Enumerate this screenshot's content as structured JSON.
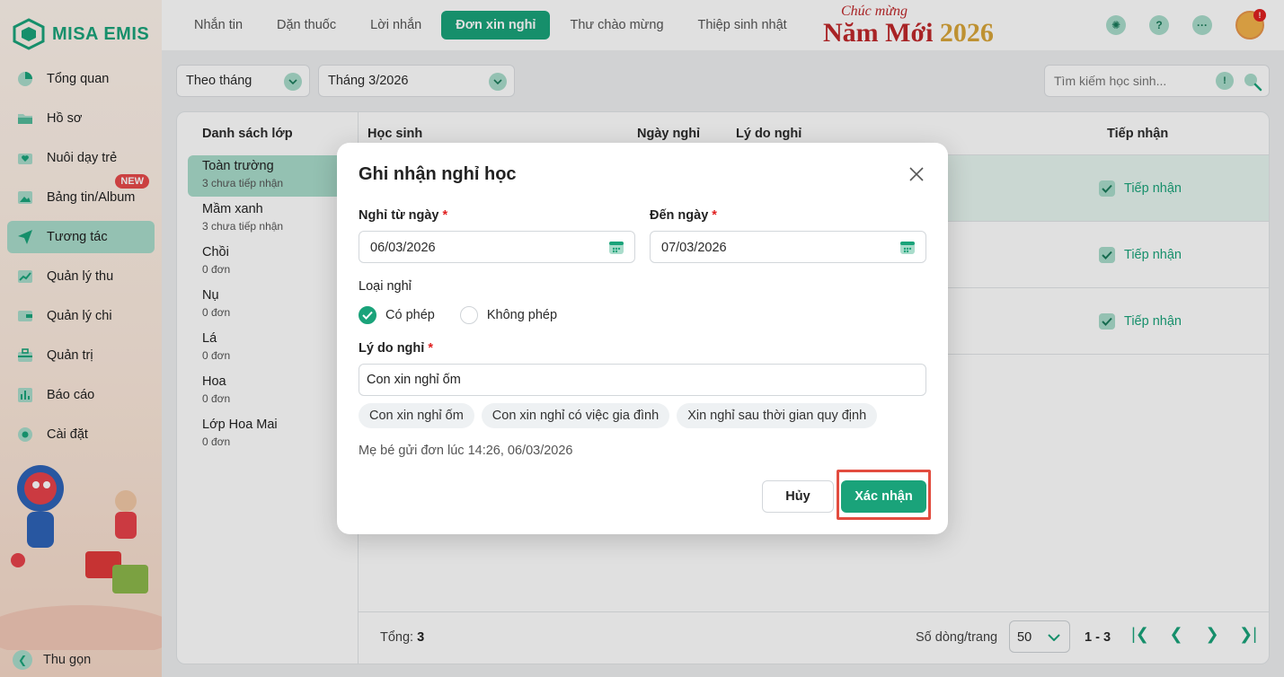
{
  "app": {
    "logo_text": "MISA EMIS"
  },
  "colors": {
    "brand": "#1aa37a",
    "brand_light": "#a9dccb",
    "danger": "#e02020",
    "highlight": "#e24c3f"
  },
  "sidebar": {
    "items": [
      {
        "label": "Tổng quan",
        "icon": "pie-chart-icon"
      },
      {
        "label": "Hồ sơ",
        "icon": "folder-icon"
      },
      {
        "label": "Nuôi dạy trẻ",
        "icon": "heart-box-icon"
      },
      {
        "label": "Bảng tin/Album",
        "icon": "image-icon",
        "badge": "NEW"
      },
      {
        "label": "Tương tác",
        "icon": "send-icon",
        "active": true
      },
      {
        "label": "Quản lý thu",
        "icon": "chart-up-icon"
      },
      {
        "label": "Quản lý chi",
        "icon": "wallet-icon"
      },
      {
        "label": "Quản trị",
        "icon": "briefcase-icon"
      },
      {
        "label": "Báo cáo",
        "icon": "bar-chart-icon"
      },
      {
        "label": "Cài đặt",
        "icon": "gear-icon"
      }
    ],
    "collapse_label": "Thu gọn"
  },
  "topbar": {
    "tabs": [
      {
        "label": "Nhắn tin"
      },
      {
        "label": "Dặn thuốc"
      },
      {
        "label": "Lời nhắn"
      },
      {
        "label": "Đơn xin nghỉ",
        "active": true
      },
      {
        "label": "Thư chào mừng"
      },
      {
        "label": "Thiệp sinh nhật"
      }
    ],
    "banner_line1": "Chúc mừng",
    "banner_line2_a": "Năm Mới ",
    "banner_line2_b": "2026",
    "help_symbol": "?",
    "more_symbol": "···",
    "notif_badge": "!"
  },
  "filters": {
    "period_type": "Theo tháng",
    "month": "Tháng 3/2026",
    "search_placeholder": "Tìm kiếm học sinh...",
    "search_info_symbol": "!"
  },
  "class_list": {
    "header": "Danh sách lớp",
    "items": [
      {
        "name": "Toàn trường",
        "sub": "3 chưa tiếp nhận",
        "count": "3",
        "active": true
      },
      {
        "name": "Mầm xanh",
        "sub": "3 chưa tiếp nhận",
        "count": "3"
      },
      {
        "name": "Chồi",
        "sub": "0 đơn"
      },
      {
        "name": "Nụ",
        "sub": "0 đơn"
      },
      {
        "name": "Lá",
        "sub": "0 đơn"
      },
      {
        "name": "Hoa",
        "sub": "0 đơn"
      },
      {
        "name": "Lớp Hoa Mai",
        "sub": "0 đơn"
      }
    ]
  },
  "table": {
    "columns": [
      "Học sinh",
      "Ngày nghỉ",
      "Lý do nghỉ",
      "Tiếp nhận"
    ],
    "rows": [
      {
        "action": "Tiếp nhận"
      },
      {
        "action": "Tiếp nhận"
      },
      {
        "action": "Tiếp nhận"
      }
    ]
  },
  "footer": {
    "total_label": "Tổng:",
    "total_value": "3",
    "rows_per_page_label": "Số dòng/trang",
    "rows_per_page_value": "50",
    "range": "1 - 3"
  },
  "modal": {
    "title": "Ghi nhận nghỉ học",
    "from_label": "Nghỉ từ ngày",
    "to_label": "Đến ngày",
    "required_mark": "*",
    "from_value": "06/03/2026",
    "to_value": "07/03/2026",
    "leave_type_label": "Loại nghỉ",
    "option_excused": "Có phép",
    "option_unexcused": "Không phép",
    "reason_label": "Lý do nghỉ",
    "reason_value": "Con xin nghỉ ốm",
    "chips": [
      "Con xin nghỉ ốm",
      "Con xin nghỉ có việc gia đình",
      "Xin nghỉ sau thời gian quy định"
    ],
    "sent_note": "Mẹ bé gửi đơn lúc 14:26, 06/03/2026",
    "cancel_label": "Hủy",
    "confirm_label": "Xác nhận"
  }
}
